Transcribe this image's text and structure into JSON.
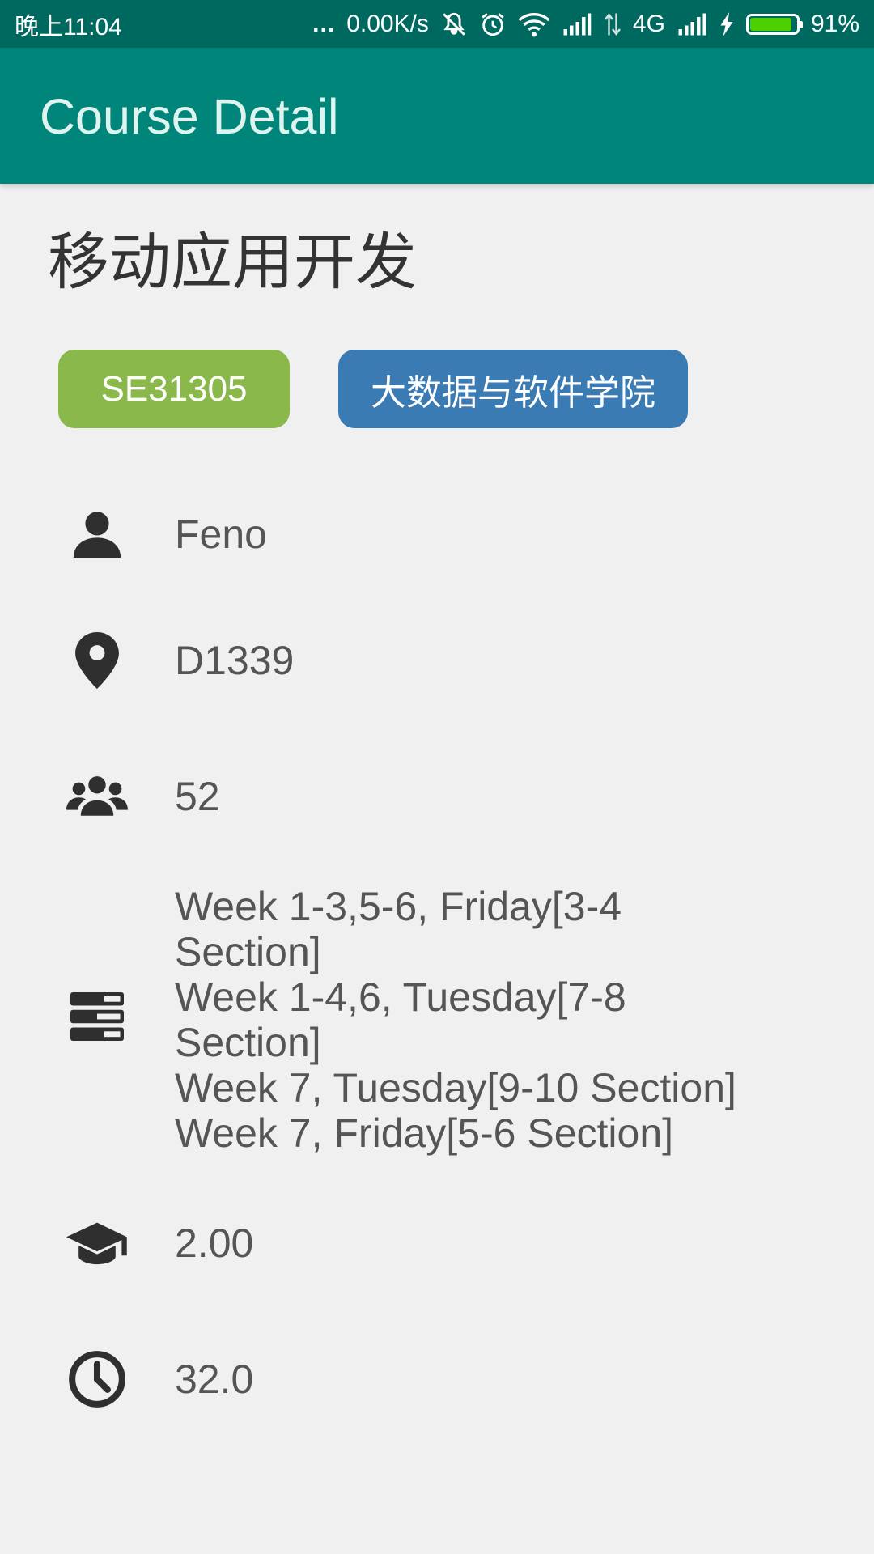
{
  "status_bar": {
    "time": "晚上11:04",
    "more": "...",
    "net_speed": "0.00K/s",
    "network_type": "4G",
    "battery_percent": "91%",
    "battery_level": 0.91,
    "icons": [
      "dots-icon",
      "mute-icon",
      "alarm-icon",
      "wifi-icon",
      "signal-icon",
      "data-arrows-icon",
      "signal-icon",
      "charging-icon",
      "battery-icon"
    ]
  },
  "app_bar": {
    "title": "Course Detail"
  },
  "course": {
    "name": "移动应用开发",
    "code": "SE31305",
    "school": "大数据与软件学院",
    "teacher": "Feno",
    "location": "D1339",
    "students": "52",
    "schedule": [
      "Week 1-3,5-6, Friday[3-4",
      "Section]",
      "Week 1-4,6, Tuesday[7-8",
      "Section]",
      "Week 7, Tuesday[9-10 Section]",
      "Week 7, Friday[5-6 Section]"
    ],
    "credits": "2.00",
    "hours": "32.0"
  },
  "colors": {
    "status_bar": "#00695f",
    "app_bar": "#00857a",
    "code_badge": "#8bb84b",
    "school_badge": "#3a7bb3",
    "icon": "#2f2f2f",
    "text": "#555555"
  },
  "row_icons": [
    "person-icon",
    "location-pin-icon",
    "group-icon",
    "schedule-icon",
    "graduation-cap-icon",
    "clock-icon"
  ]
}
